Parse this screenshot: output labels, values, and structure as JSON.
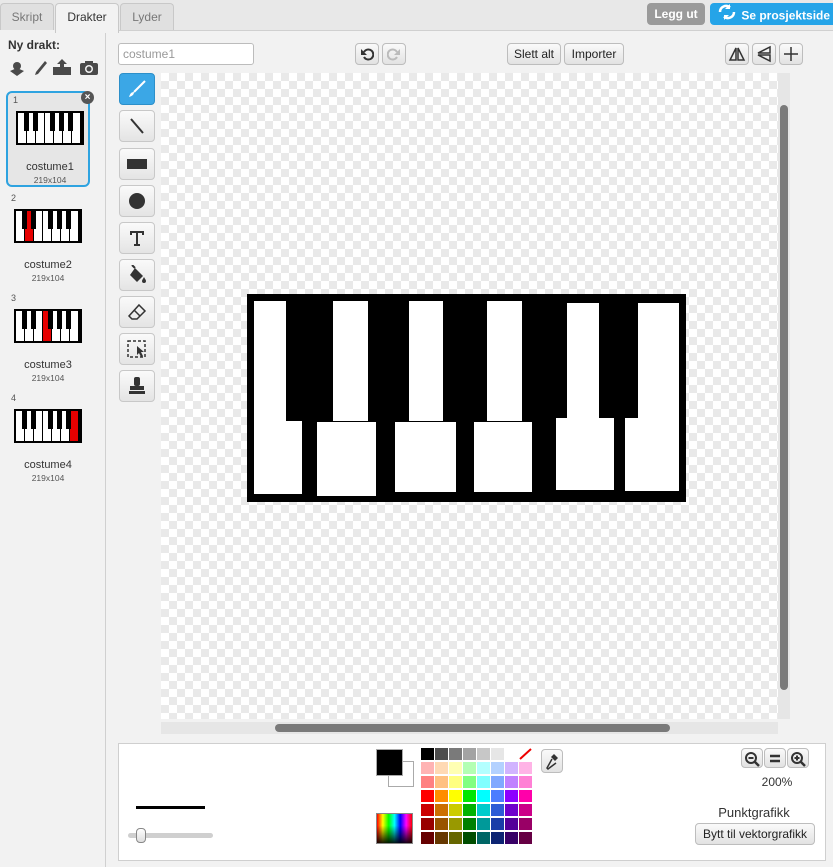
{
  "tabs": [
    "Skript",
    "Drakter",
    "Lyder"
  ],
  "header": {
    "logout_label": "Legg ut",
    "project_page_label": "Se prosjektside"
  },
  "new_costume": {
    "label": "Ny drakt:",
    "icons": [
      "choose-from-library-icon",
      "paint-new-icon",
      "upload-icon",
      "camera-icon"
    ]
  },
  "costumes": [
    {
      "num": "1",
      "name": "costume1",
      "size": "219x104",
      "red_key": null
    },
    {
      "num": "2",
      "name": "costume2",
      "size": "219x104",
      "red_key": "white-1"
    },
    {
      "num": "3",
      "name": "costume3",
      "size": "219x104",
      "red_key": "white-3"
    },
    {
      "num": "4",
      "name": "costume4",
      "size": "219x104",
      "red_key": "white-6"
    }
  ],
  "editor": {
    "costume_name_value": "costume1",
    "clear_label": "Slett alt",
    "import_label": "Importer",
    "tools": [
      "brush-tool-icon",
      "line-tool-icon",
      "rectangle-tool-icon",
      "ellipse-tool-icon",
      "text-tool-icon",
      "fill-tool-icon",
      "eraser-tool-icon",
      "select-tool-icon",
      "stamp-tool-icon"
    ],
    "zoom_level": "200%",
    "mode_label": "Punktgrafikk",
    "convert_label": "Bytt til vektorgrafikk",
    "current_color": "#000000"
  },
  "palette": [
    [
      "#000000",
      "#4d4d4d",
      "#7a7a7a",
      "#a3a3a3",
      "#c7c7c7",
      "#e6e6e6",
      "#ffffff",
      "none"
    ],
    [
      "#ffb3b3",
      "#ffd9b3",
      "#ffffb3",
      "#b3ffb3",
      "#b3ffff",
      "#b3d1ff",
      "#d1b3ff",
      "#ffb3e6"
    ],
    [
      "#ff8080",
      "#ffc080",
      "#ffff80",
      "#80ff80",
      "#80ffff",
      "#80a8ff",
      "#c080ff",
      "#ff80d5"
    ],
    [
      "#ff0000",
      "#ff8c00",
      "#ffff00",
      "#00e600",
      "#00ffff",
      "#4d7dff",
      "#8c00ff",
      "#ff00aa"
    ],
    [
      "#cc0000",
      "#cc7000",
      "#cccc00",
      "#00b300",
      "#00cccc",
      "#2d5cd6",
      "#7000cc",
      "#cc0088"
    ],
    [
      "#990000",
      "#995400",
      "#999900",
      "#008000",
      "#009999",
      "#1a3da8",
      "#540099",
      "#990066"
    ],
    [
      "#660000",
      "#663800",
      "#666600",
      "#004d00",
      "#006666",
      "#0d2473",
      "#380066",
      "#660044"
    ]
  ]
}
